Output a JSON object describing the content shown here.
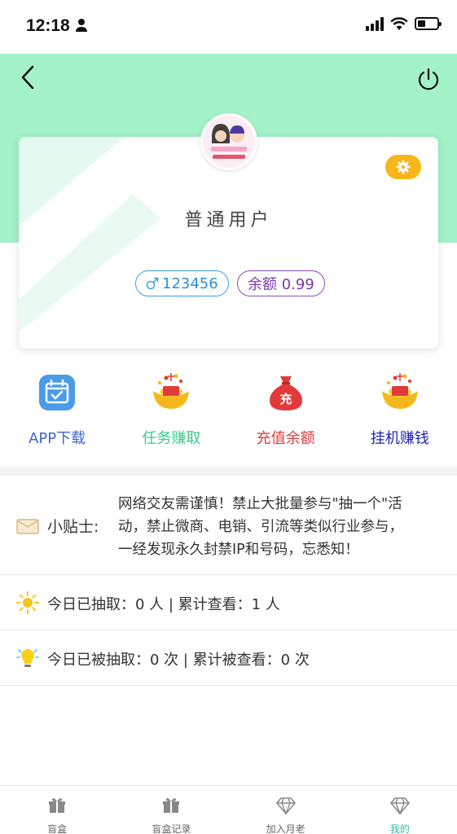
{
  "status": {
    "time": "12:18"
  },
  "user": {
    "name": "普通用户",
    "id": "123456",
    "balance_label": "余额 0.99"
  },
  "actions": [
    {
      "label": "APP下载",
      "color": "#3d67c9",
      "icon": "calendar-icon"
    },
    {
      "label": "任务赚取",
      "color": "#33cc88",
      "icon": "gold-ingot-icon"
    },
    {
      "label": "充值余额",
      "color": "#e03a3a",
      "icon": "money-bag-icon"
    },
    {
      "label": "挂机赚钱",
      "color": "#1f1fb3",
      "icon": "gold-ingot-icon"
    }
  ],
  "tip": {
    "label": "小贴士:",
    "lines": [
      "网络交友需谨慎！禁止大批量参与\"抽一个\"活",
      "动，禁止微商、电销、引流等类似行业参与，",
      "一经发现永久封禁IP和号码，忘悉知！"
    ]
  },
  "stats": [
    {
      "text": "今日已抽取：0 人 | 累计查看：1 人",
      "icon": "sun-icon"
    },
    {
      "text": "今日已被抽取：0 次 | 累计被查看：0 次",
      "icon": "bulb-icon"
    }
  ],
  "tabs": [
    {
      "label": "盲盒",
      "icon": "gift-icon",
      "active": false
    },
    {
      "label": "盲盒记录",
      "icon": "gift-icon",
      "active": false
    },
    {
      "label": "加入月老",
      "icon": "diamond-icon",
      "active": false
    },
    {
      "label": "我的",
      "icon": "diamond-icon",
      "active": true
    }
  ],
  "colors": {
    "header": "#a3f2c8",
    "accent": "#2cc0a0",
    "settings": "#f7b619"
  }
}
